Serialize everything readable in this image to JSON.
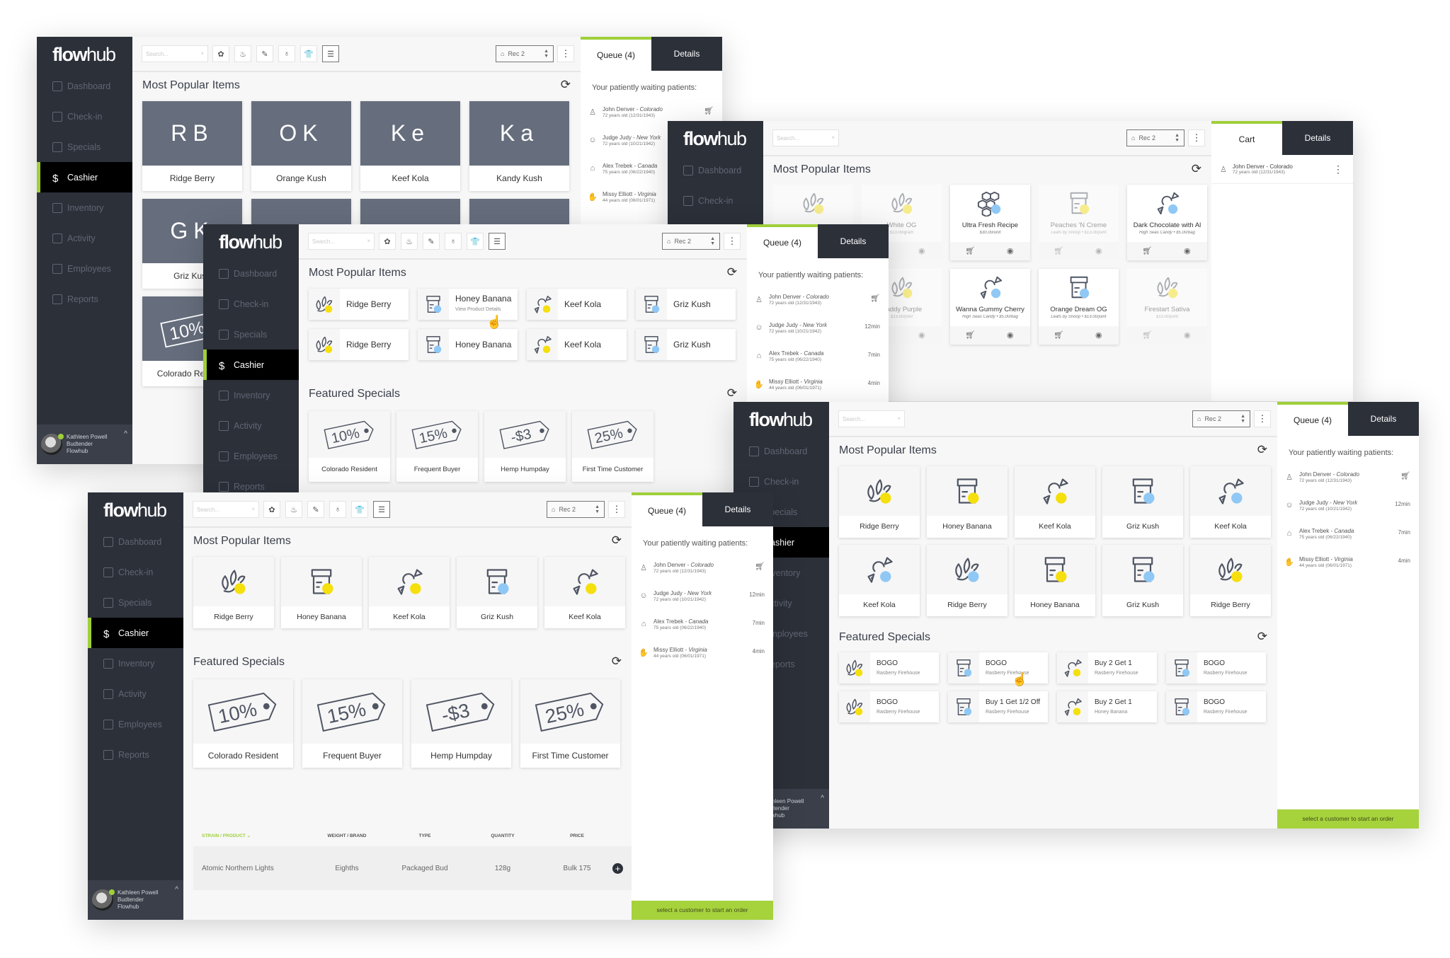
{
  "brand": "flowhub",
  "nav": [
    "Dashboard",
    "Check-in",
    "Specials",
    "Cashier",
    "Inventory",
    "Activity",
    "Employees",
    "Reports"
  ],
  "nav_icons": [
    "home-icon",
    "check-in-icon",
    "tag-icon",
    "dollar-icon",
    "clipboard-icon",
    "bar-chart-icon",
    "employees-icon",
    "document-icon"
  ],
  "active_nav": "Cashier",
  "user": {
    "name": "Kathleen Powell",
    "role": "Budtender",
    "org": "Flowhub"
  },
  "toolbar": {
    "search_placeholder": "Search...",
    "register": "Rec 2",
    "filters": [
      "cannabis-icon",
      "edibles-icon",
      "concentrate-icon",
      "bottle-icon",
      "apparel-icon",
      "list-icon"
    ]
  },
  "sections": {
    "popular": "Most Popular Items",
    "featured": "Featured Specials"
  },
  "queue": {
    "tab": "Queue (4)",
    "details": "Details",
    "heading": "Your patiently waiting patients:",
    "patients": [
      {
        "name": "John Denver",
        "location": "Colorado",
        "age": "72 years old (12/31/1943)",
        "wait": "",
        "icon": "person-icon"
      },
      {
        "name": "Judge Judy",
        "location": "New York",
        "age": "72 years old (10/21/1942)",
        "wait": "12min",
        "icon": "group-icon"
      },
      {
        "name": "Alex Trebek",
        "location": "Canada",
        "age": "75 years old (06/22/1940)",
        "wait": "7min",
        "icon": "house-icon"
      },
      {
        "name": "Missy Elliott",
        "location": "Virginia",
        "age": "44 years old (06/01/1971)",
        "wait": "4min",
        "icon": "hand-icon"
      }
    ],
    "cta": "select a customer to start an order"
  },
  "cart": {
    "tab": "Cart",
    "details": "Details",
    "customer": {
      "name": "John Denver - Colorado",
      "age": "72 years old (12/31/1943)"
    }
  },
  "colors": {
    "accent": "#a6d23c",
    "sidebar": "#2c3039",
    "tile": "#666e7d",
    "yellow": "#f5df0c",
    "blue": "#8fc8f5"
  },
  "windows": {
    "w1": {
      "popular": [
        {
          "initials": "RB",
          "name": "Ridge Berry"
        },
        {
          "initials": "OK",
          "name": "Orange Kush"
        },
        {
          "initials": "Ke",
          "name": "Keef Kola"
        },
        {
          "initials": "Ka",
          "name": "Kandy Kush"
        },
        {
          "initials": "GK",
          "name": "Griz Kush"
        },
        {
          "initials": "",
          "name": ""
        },
        {
          "initials": "",
          "name": ""
        },
        {
          "initials": "",
          "name": ""
        }
      ],
      "special": {
        "tag": "10%",
        "name": "Colorado Resident"
      }
    },
    "w2": {
      "products": [
        {
          "name": "",
          "sub": "",
          "icon": "plant",
          "dot": "yellow",
          "faded": true
        },
        {
          "name": "White OG",
          "sub": "$13.00/gram",
          "icon": "plant",
          "dot": "yellow",
          "faded": true
        },
        {
          "name": "Ultra Fresh Recipe",
          "sub": "$30.00/unit",
          "icon": "honeycomb",
          "dot": "blue",
          "faded": false
        },
        {
          "name": "Peaches 'N Creme",
          "sub": "Leafs by Snoop • $13.00/joint",
          "icon": "jar",
          "dot": "yellow",
          "faded": true
        },
        {
          "name": "Dark Chocolate with Al",
          "sub": "High Seas Candy • $5.00/bag",
          "icon": "candy",
          "dot": "blue",
          "faded": false
        },
        {
          "name": "",
          "sub": "",
          "icon": "plant",
          "dot": "yellow",
          "faded": true
        },
        {
          "name": "Daddy Purple",
          "sub": "$13.00/joint",
          "icon": "plant",
          "dot": "yellow",
          "faded": true
        },
        {
          "name": "Wanna Gummy Cherry",
          "sub": "High Seas Candy • $5.00/bag",
          "icon": "candy",
          "dot": "blue",
          "faded": false
        },
        {
          "name": "Orange Dream OG",
          "sub": "Leafs by Snoop • $13.00/joint",
          "icon": "jar",
          "dot": "blue",
          "faded": false
        },
        {
          "name": "Firestart Sativa",
          "sub": "$13.00/joint",
          "icon": "plant",
          "dot": "yellow",
          "faded": true
        }
      ]
    },
    "w3": {
      "popular": [
        {
          "name": "Ridge Berry",
          "sub": "",
          "icon": "plant",
          "dot": "yellow"
        },
        {
          "name": "Honey Banana",
          "sub": "View Product Details",
          "icon": "jar",
          "dot": "blue"
        },
        {
          "name": "Keef Kola",
          "sub": "",
          "icon": "candy",
          "dot": "yellow"
        },
        {
          "name": "Griz Kush",
          "sub": "",
          "icon": "jar",
          "dot": "blue"
        },
        {
          "name": "Ridge Berry",
          "sub": "",
          "icon": "plant",
          "dot": "yellow"
        },
        {
          "name": "Honey Banana",
          "sub": "",
          "icon": "jar",
          "dot": "blue"
        },
        {
          "name": "Keef Kola",
          "sub": "",
          "icon": "candy",
          "dot": "yellow"
        },
        {
          "name": "Griz Kush",
          "sub": "",
          "icon": "jar",
          "dot": "blue"
        }
      ],
      "specials": [
        {
          "tag": "10%",
          "name": "Colorado Resident"
        },
        {
          "tag": "15%",
          "name": "Frequent Buyer"
        },
        {
          "tag": "-$3",
          "name": "Hemp Humpday"
        },
        {
          "tag": "25%",
          "name": "First Time Customer"
        }
      ]
    },
    "w4": {
      "popular": [
        {
          "name": "Ridge Berry",
          "icon": "plant",
          "dot": "yellow"
        },
        {
          "name": "Honey Banana",
          "icon": "jar",
          "dot": "yellow"
        },
        {
          "name": "Keef Kola",
          "icon": "candy",
          "dot": "yellow"
        },
        {
          "name": "Griz Kush",
          "icon": "jar",
          "dot": "blue"
        },
        {
          "name": "Keef Kola",
          "icon": "candy",
          "dot": "blue"
        },
        {
          "name": "Keef Kola",
          "icon": "candy",
          "dot": "blue"
        },
        {
          "name": "Ridge Berry",
          "icon": "plant",
          "dot": "blue"
        },
        {
          "name": "Honey Banana",
          "icon": "jar",
          "dot": "yellow"
        },
        {
          "name": "Griz Kush",
          "icon": "jar",
          "dot": "blue"
        },
        {
          "name": "Ridge Berry",
          "icon": "plant",
          "dot": "yellow"
        }
      ],
      "specials": [
        {
          "name": "BOGO",
          "sub": "Rasberry Firehouse",
          "icon": "plant",
          "dot": "yellow"
        },
        {
          "name": "BOGO",
          "sub": "Rasberry Firehouse",
          "icon": "jar",
          "dot": "blue"
        },
        {
          "name": "Buy 2 Get 1",
          "sub": "Rasberry Firehouse",
          "icon": "candy",
          "dot": "yellow"
        },
        {
          "name": "BOGO",
          "sub": "Rasberry Firehouse",
          "icon": "jar",
          "dot": "blue"
        },
        {
          "name": "BOGO",
          "sub": "Rasberry Firehouse",
          "icon": "plant",
          "dot": "yellow"
        },
        {
          "name": "Buy 1 Get 1/2 Off",
          "sub": "Rasberry Firehouse",
          "icon": "jar",
          "dot": "blue"
        },
        {
          "name": "Buy 2 Get 1",
          "sub": "Honey Banana",
          "icon": "candy",
          "dot": "yellow"
        },
        {
          "name": "BOGO",
          "sub": "Rasberry Firehouse",
          "icon": "jar",
          "dot": "blue"
        }
      ]
    },
    "w5": {
      "popular": [
        {
          "name": "Ridge Berry",
          "icon": "plant",
          "dot": "yellow"
        },
        {
          "name": "Honey Banana",
          "icon": "jar",
          "dot": "yellow"
        },
        {
          "name": "Keef Kola",
          "icon": "candy",
          "dot": "yellow"
        },
        {
          "name": "Griz Kush",
          "icon": "jar",
          "dot": "blue"
        },
        {
          "name": "Keef Kola",
          "icon": "candy",
          "dot": "yellow"
        }
      ],
      "specials": [
        {
          "tag": "10%",
          "name": "Colorado Resident"
        },
        {
          "tag": "15%",
          "name": "Frequent Buyer"
        },
        {
          "tag": "-$3",
          "name": "Hemp Humpday"
        },
        {
          "tag": "25%",
          "name": "First Time Customer"
        }
      ],
      "table": {
        "columns": [
          "STRAIN / PRODUCT",
          "WEIGHT / BRAND",
          "TYPE",
          "QUANTITY",
          "PRICE"
        ],
        "rows": [
          [
            "Atomic Northern Lights",
            "Eighths",
            "Packaged Bud",
            "128g",
            "Bulk 175"
          ]
        ]
      }
    }
  }
}
